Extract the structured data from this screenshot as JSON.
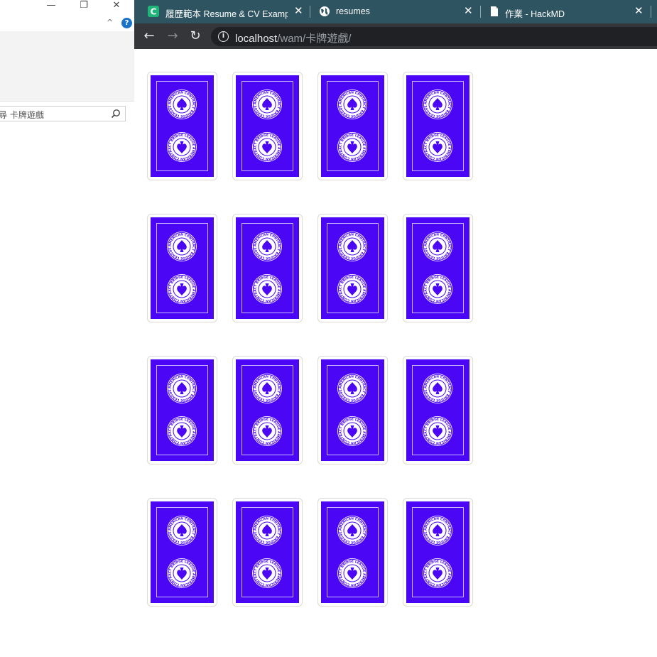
{
  "explorer": {
    "window_controls": {
      "minimize": "—",
      "restore": "❐",
      "close": "✕"
    },
    "search": {
      "text": "尋 卡牌遊戲"
    }
  },
  "browser": {
    "tabs": [
      {
        "title": "履歷範本 Resume & CV Exampl",
        "favicon": "c-logo-icon",
        "favicon_color": "#1fb478"
      },
      {
        "title": "resumes",
        "favicon": "globe-icon"
      },
      {
        "title": "作業 - HackMD",
        "favicon": "document-icon"
      }
    ],
    "tab_close_glyph": "✕",
    "address": {
      "host": "localhost",
      "path": "/wam/卡牌遊戲/"
    }
  },
  "cards": {
    "rows": 4,
    "cols": 4,
    "back_color": "#4a06f5",
    "emblem_text": "AMERICAN CONTRACT BRIDGE LEAGUE",
    "items": [
      {
        "state": "face-down"
      },
      {
        "state": "face-down"
      },
      {
        "state": "face-down"
      },
      {
        "state": "face-down"
      },
      {
        "state": "face-down"
      },
      {
        "state": "face-down"
      },
      {
        "state": "face-down"
      },
      {
        "state": "face-down"
      },
      {
        "state": "face-down"
      },
      {
        "state": "face-down"
      },
      {
        "state": "face-down"
      },
      {
        "state": "face-down"
      },
      {
        "state": "face-down"
      },
      {
        "state": "face-down"
      },
      {
        "state": "face-down"
      },
      {
        "state": "face-down"
      }
    ]
  }
}
